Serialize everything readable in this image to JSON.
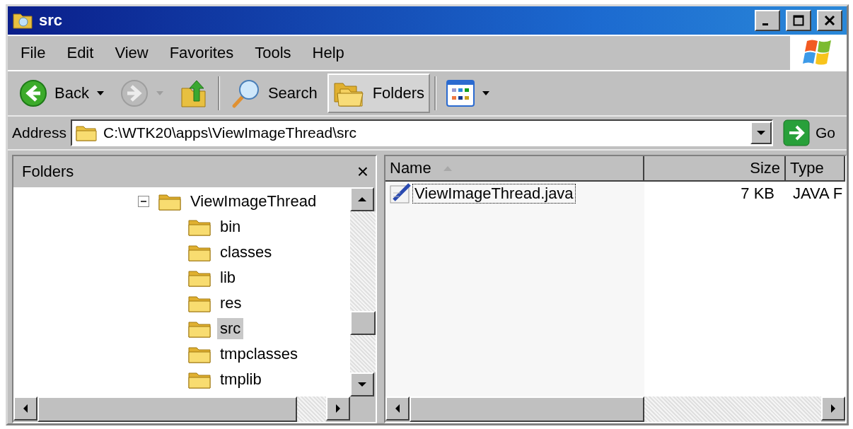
{
  "window": {
    "title": "src"
  },
  "menu": [
    "File",
    "Edit",
    "View",
    "Favorites",
    "Tools",
    "Help"
  ],
  "toolbar": [
    {
      "kind": "back",
      "label": "Back",
      "disabled": false,
      "selected": false
    },
    {
      "kind": "forward",
      "disabled": true,
      "selected": false
    },
    {
      "kind": "up",
      "disabled": false,
      "selected": false
    },
    {
      "kind": "search",
      "label": "Search",
      "disabled": false,
      "selected": false
    },
    {
      "kind": "folders",
      "label": "Folders",
      "disabled": false,
      "selected": true
    },
    {
      "kind": "views",
      "disabled": false,
      "selected": false
    }
  ],
  "address": {
    "label": "Address",
    "value": "C:\\WTK20\\apps\\ViewImageThread\\src",
    "go": "Go"
  },
  "folders_pane": {
    "title": "Folders",
    "close": "×",
    "tree": [
      {
        "label": "ViewImageThread",
        "expanded": true,
        "selected": false,
        "children": [
          {
            "label": "bin",
            "selected": false
          },
          {
            "label": "classes",
            "selected": false
          },
          {
            "label": "lib",
            "selected": false
          },
          {
            "label": "res",
            "selected": false
          },
          {
            "label": "src",
            "selected": true
          },
          {
            "label": "tmpclasses",
            "selected": false
          },
          {
            "label": "tmplib",
            "selected": false
          }
        ]
      }
    ]
  },
  "file_list": {
    "columns": [
      {
        "label": "Name",
        "sorted": true
      },
      {
        "label": "Size",
        "sorted": false
      },
      {
        "label": "Type",
        "sorted": false
      }
    ],
    "rows": [
      {
        "name": "ViewImageThread.java",
        "size": "7 KB",
        "type": "JAVA F",
        "focused": true
      }
    ]
  }
}
